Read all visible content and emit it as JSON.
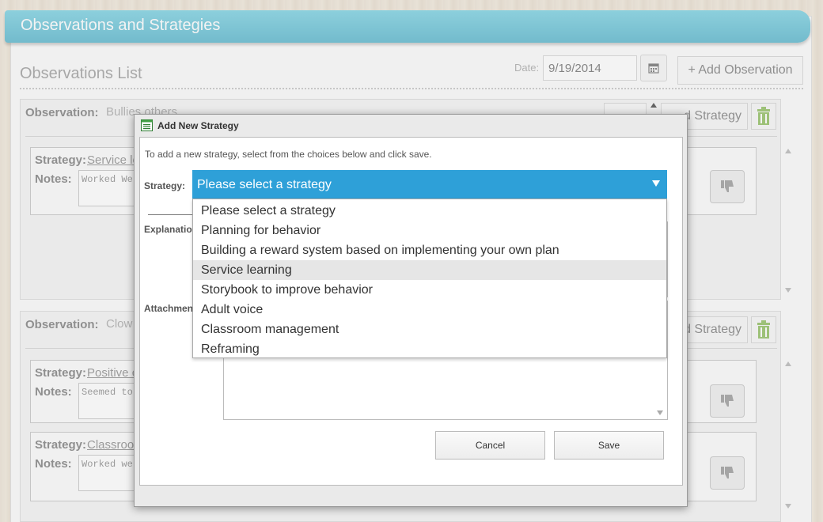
{
  "header": {
    "title": "Observations and Strategies"
  },
  "list": {
    "title": "Observations List",
    "date_label": "Date:",
    "date_value": "9/19/2014",
    "add_observation_label": "+ Add Observation"
  },
  "observations": [
    {
      "label": "Observation:",
      "value": "Bullies others",
      "add_strategy_label": "d Strategy",
      "strategies": [
        {
          "label": "Strategy:",
          "name": "Service lo",
          "notes_label": "Notes:",
          "notes": "Worked We"
        }
      ]
    },
    {
      "label": "Observation:",
      "value": "Clow",
      "add_strategy_label": "d Strategy",
      "strategies": [
        {
          "label": "Strategy:",
          "name": "Positive c",
          "notes_label": "Notes:",
          "notes": "Seemed to"
        },
        {
          "label": "Strategy:",
          "name": "Classroo",
          "notes_label": "Notes:",
          "notes": "Worked we"
        }
      ]
    }
  ],
  "modal": {
    "title": "Add New Strategy",
    "intro": "To add a new strategy, select from the choices below and click save.",
    "strategy_label": "Strategy:",
    "explanation_label": "Explanatio",
    "attachments_label": "Attachmen",
    "selected": "Please select a strategy",
    "options": [
      "Please select a strategy",
      "Planning for behavior",
      "Building a reward system based on implementing your own plan",
      "Service learning",
      "Storybook to improve behavior",
      "Adult voice",
      "Classroom management",
      "Reframing"
    ],
    "hovered_option": "Service learning",
    "cancel_label": "Cancel",
    "save_label": "Save"
  },
  "colors": {
    "banner": "#3aa9c4",
    "select_accent": "#2ea0d8",
    "trash_green": "#7cb342"
  },
  "icons": [
    "calendar-icon",
    "trash-icon",
    "thumbs-down-icon",
    "form-icon",
    "caret-down-icon"
  ]
}
